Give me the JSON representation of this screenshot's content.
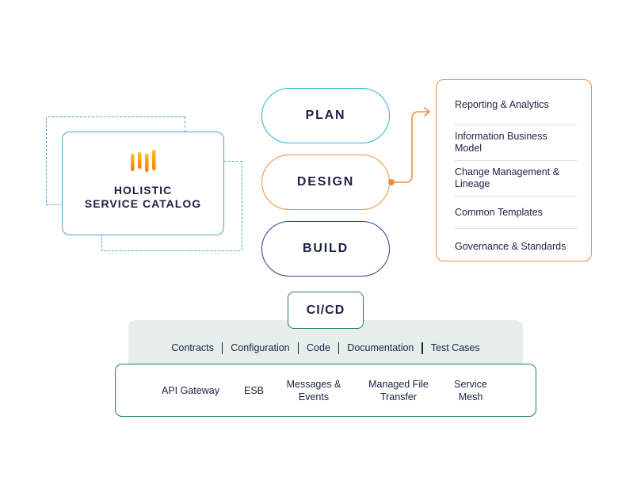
{
  "catalog": {
    "title_line1": "HOLISTIC",
    "title_line2": "SERVICE CATALOG",
    "logo_icon": "bar-chart-logo-icon",
    "logo_gradient": [
      "#ffc21a",
      "#ff7a00"
    ]
  },
  "phases": [
    {
      "label": "PLAN",
      "color": "#27b8cf"
    },
    {
      "label": "DESIGN",
      "color": "#ec8f3c"
    },
    {
      "label": "BUILD",
      "color": "#2e3a9b"
    }
  ],
  "design_panel": {
    "items": [
      "Reporting & Analytics",
      "Information Business Model",
      "Change Management & Lineage",
      "Common Templates",
      "Governance & Standards"
    ]
  },
  "cicd": {
    "label": "CI/CD",
    "artifacts": [
      "Contracts",
      "Configuration",
      "Code",
      "Documentation",
      "Test Cases"
    ]
  },
  "integrations": [
    "API Gateway",
    "ESB",
    "Messages & Events",
    "Managed File Transfer",
    "Service Mesh"
  ],
  "colors": {
    "text": "#1b2142",
    "catalog_border": "#4aa6d9",
    "cicd_border": "#1e7e6a",
    "cicd_band": "#e6eeec"
  }
}
